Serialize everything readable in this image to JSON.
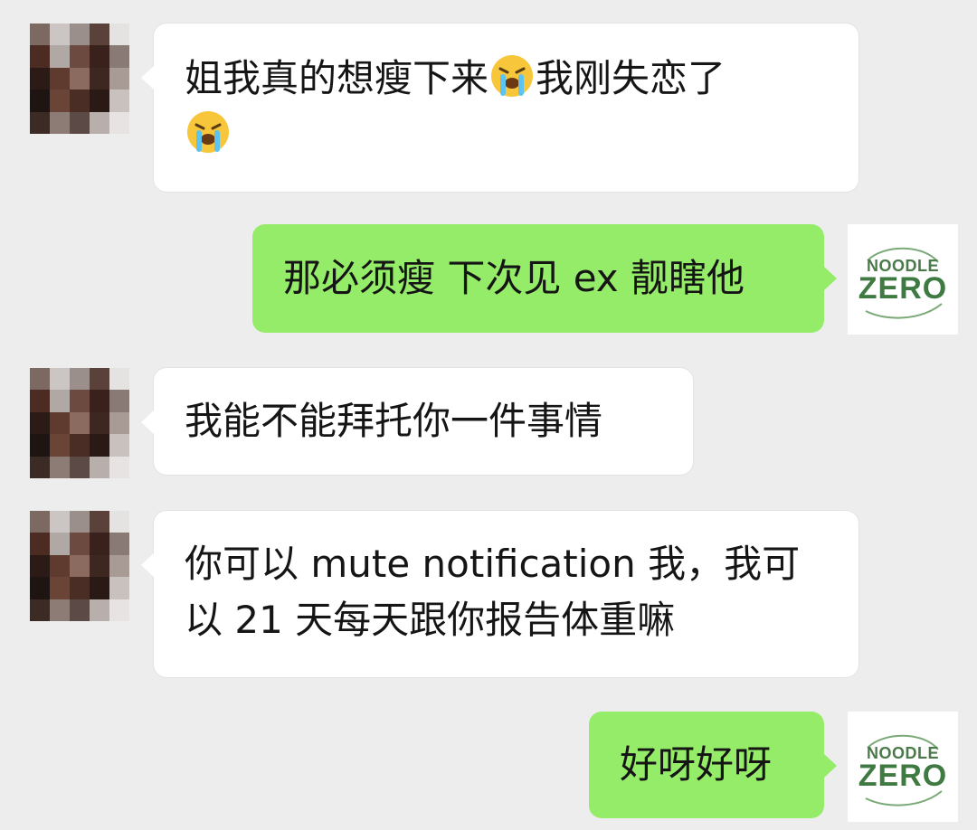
{
  "colors": {
    "background": "#ededed",
    "incoming_bubble": "#ffffff",
    "outgoing_bubble": "#95ec69",
    "logo_green": "#3f7a42"
  },
  "contact_avatar": {
    "icon": "pixelated-avatar",
    "palette": [
      [
        "#7c6a62",
        "#cbc6c4",
        "#9b8f8b",
        "#5a4139",
        "#e5e2e2"
      ],
      [
        "#4c2b23",
        "#b0a8a5",
        "#6d4a40",
        "#3a221c",
        "#8a7a75"
      ],
      [
        "#2b1a16",
        "#5f3b2f",
        "#8b6a5f",
        "#3e2720",
        "#a89b96"
      ],
      [
        "#1e1411",
        "#6a4437",
        "#4a2e25",
        "#2a1a15",
        "#c9c1be"
      ],
      [
        "#3c2a24",
        "#8d7c76",
        "#5b4a45",
        "#b8aeab",
        "#e6e3e2"
      ]
    ]
  },
  "brand_avatar": {
    "icon": "noodle-zero-logo",
    "line1": "NOODLE",
    "line2": "ZERO"
  },
  "messages": [
    {
      "side": "left",
      "line1": "姐我真的想瘦下来",
      "emoji": "crying-face-emoji",
      "line1b": "我刚失恋了"
    },
    {
      "side": "right",
      "text": "那必须瘦 下次见 ex 靓瞎他"
    },
    {
      "side": "left",
      "text": "我能不能拜托你一件事情"
    },
    {
      "side": "left",
      "line1": "你可以 mute notification 我，我可",
      "line2": "以 21 天每天跟你报告体重嘛"
    },
    {
      "side": "right",
      "text": "好呀好呀"
    }
  ]
}
